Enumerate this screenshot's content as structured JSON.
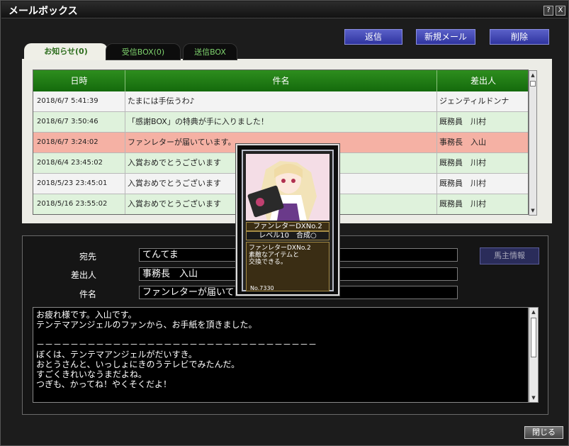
{
  "window": {
    "title": "メールボックス",
    "help": "?",
    "close": "X"
  },
  "actions": {
    "reply": "返信",
    "new_mail": "新規メール",
    "delete": "削除"
  },
  "tabs": [
    {
      "label": "お知らせ(0)"
    },
    {
      "label": "受信BOX(0)"
    },
    {
      "label": "送信BOX"
    }
  ],
  "table": {
    "headers": {
      "date": "日時",
      "subject": "件名",
      "from": "差出人"
    },
    "rows": [
      {
        "date": "2018/6/7 5:41:39",
        "subject": "たまには手伝うわ♪",
        "from": "ジェンティルドンナ"
      },
      {
        "date": "2018/6/7 3:50:46",
        "subject": "「感謝BOX」の特典が手に入りました！",
        "from": "厩務員　川村"
      },
      {
        "date": "2018/6/7 3:24:02",
        "subject": "ファンレターが届いています。",
        "from": "事務長　入山"
      },
      {
        "date": "2018/6/4 23:45:02",
        "subject": "入賞おめでとうございます",
        "from": "厩務員　川村"
      },
      {
        "date": "2018/5/23 23:45:01",
        "subject": "入賞おめでとうございます",
        "from": "厩務員　川村"
      },
      {
        "date": "2018/5/16 23:55:02",
        "subject": "入賞おめでとうございます",
        "from": "厩務員　川村"
      }
    ]
  },
  "detail": {
    "to_label": "宛先",
    "to_value": "てんてま",
    "from_label": "差出人",
    "from_value": "事務長　入山",
    "subject_label": "件名",
    "subject_value": "ファンレターが届いて",
    "owner_info": "馬主情報",
    "body": "お疲れ様です。入山です。\nテンテマアンジェルのファンから、お手紙を頂きました。\n\n－－－－－－－－－－－－－－－－－－－－－－－－－－－－－－－－－\nぼくは、テンテマアンジェルがだいすき。\nおとうさんと、いっしょにきのうテレビでみたんだ。\nすごくきれいなうまだよね。\nつぎも、かってね！やくそくだよ！"
  },
  "card": {
    "name": "ファンレターDXNo.2",
    "level": "レベル10　合成○",
    "desc": "ファンレターDXNo.2\n素敵なアイテムと\n交換できる。",
    "no": "No.7330"
  },
  "footer": {
    "close": "閉じる"
  }
}
